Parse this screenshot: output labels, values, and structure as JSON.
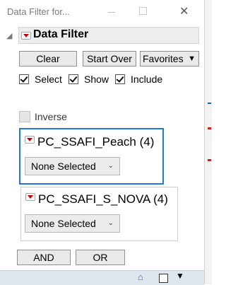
{
  "window": {
    "title": "Data Filter for..."
  },
  "outline": {
    "title": "Data Filter"
  },
  "toolbar": {
    "clear_label": "Clear",
    "start_over_label": "Start Over",
    "favorites_label": "Favorites"
  },
  "options": {
    "select_label": "Select",
    "show_label": "Show",
    "include_label": "Include",
    "inverse_label": "Inverse"
  },
  "filters": [
    {
      "title": "PC_SSAFI_Peach (4)",
      "value": "None Selected"
    },
    {
      "title": "PC_SSAFI_S_NOVA (4)",
      "value": "None Selected"
    }
  ],
  "buttons": {
    "and_label": "AND",
    "or_label": "OR"
  },
  "colors": {
    "selection_border": "#1e7bd0",
    "disclosure_red": "#cc0000"
  }
}
